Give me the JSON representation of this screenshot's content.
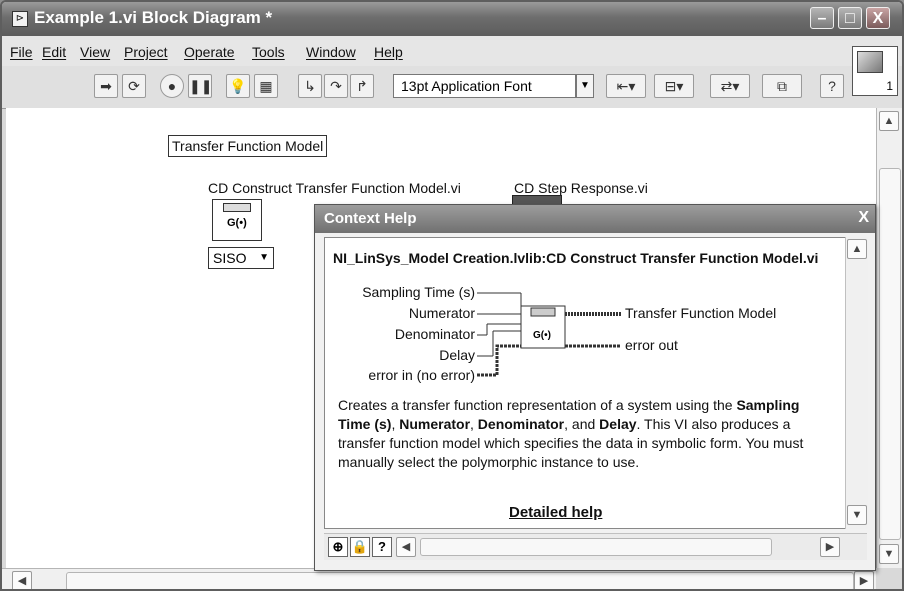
{
  "window": {
    "title": "Example 1.vi Block Diagram *",
    "controls": {
      "minimize": "–",
      "maximize": "□",
      "close": "X"
    }
  },
  "menu": [
    {
      "label": "File"
    },
    {
      "label": "Edit"
    },
    {
      "label": "View"
    },
    {
      "label": "Project"
    },
    {
      "label": "Operate"
    },
    {
      "label": "Tools"
    },
    {
      "label": "Window"
    },
    {
      "label": "Help"
    }
  ],
  "toolbar": {
    "font_select_value": "13pt Application Font",
    "vi_icon_number": "1",
    "icons": [
      "run-arrow-icon",
      "run-continuously-icon",
      "abort-icon",
      "pause-icon",
      "highlight-execution-icon",
      "retain-wire-values-icon",
      "step-into-icon",
      "step-over-icon",
      "step-out-icon",
      "align-objects-icon",
      "distribute-objects-icon",
      "reorder-icon",
      "clean-up-diagram-icon",
      "context-help-icon"
    ]
  },
  "diagram": {
    "constant_label": "Transfer Function Model",
    "construct_vi_label": "CD Construct Transfer Function Model.vi",
    "step_vi_label": "CD Step Response.vi",
    "node_glyph": "G(•)",
    "selector_value": "SISO"
  },
  "context_help": {
    "title": "Context Help",
    "close": "X",
    "heading": "NI_LinSys_Model Creation.lvlib:CD Construct Transfer Function Model.vi",
    "inputs": [
      "Sampling Time (s)",
      "Numerator",
      "Denominator",
      "Delay",
      "error in (no error)"
    ],
    "outputs": [
      "Transfer Function Model",
      "error out"
    ],
    "node_glyph": "G(•)",
    "desc_1": "Creates a transfer function representation of a system using the",
    "desc_bold_1": "Sampling Time (s)",
    "desc_sep_1": ", ",
    "desc_bold_2": "Numerator",
    "desc_sep_2": ", ",
    "desc_bold_3": "Denominator",
    "desc_sep_3": ", and ",
    "desc_bold_4": "Delay",
    "desc_2": ". This VI also produces a transfer function model which specifies the data in symbolic form. You must manually select the polymorphic instance to use.",
    "link": "Detailed help",
    "bottom_question": "?"
  }
}
